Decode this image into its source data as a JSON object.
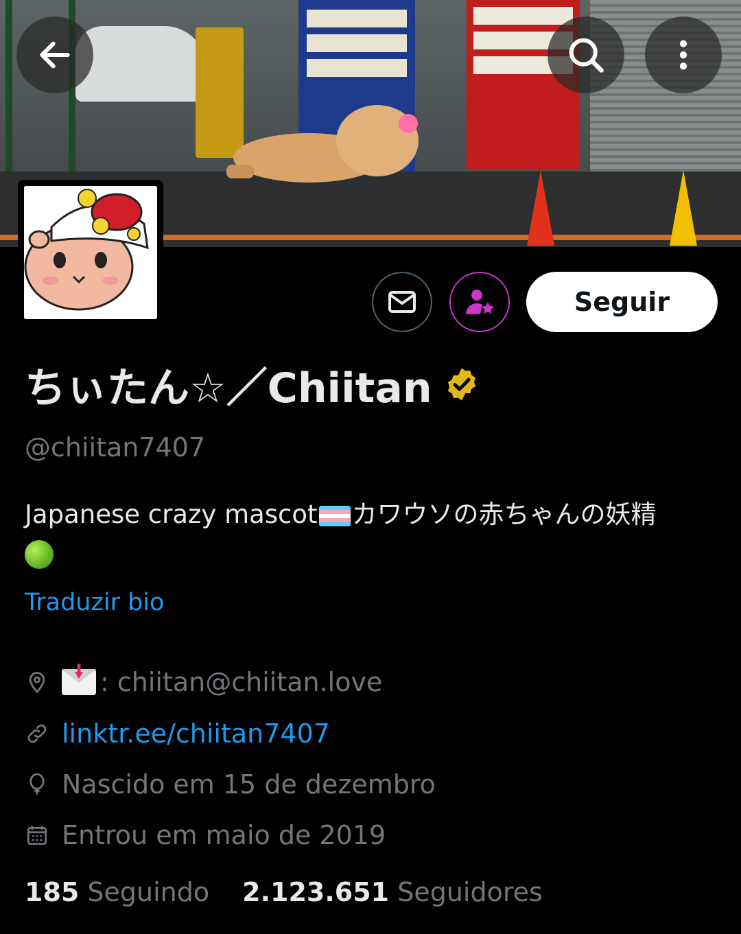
{
  "header": {
    "back_icon": "arrow-left-icon",
    "search_icon": "search-icon",
    "more_icon": "more-vertical-icon"
  },
  "actions": {
    "message_icon": "mail-icon",
    "subscribe_icon": "user-star-icon",
    "follow_label": "Seguir"
  },
  "profile": {
    "name": "ちぃたん☆／Chiitan",
    "verified_icon": "verified-badge-icon",
    "handle": "@chiitan7407",
    "bio_part1": "Japanese crazy mascot",
    "bio_part2": "カワウソの赤ちゃんの妖精",
    "translate_label": "Traduzir bio"
  },
  "meta": {
    "location_icon": "location-pin-icon",
    "location_suffix": ":  chiitan@chiitan.love",
    "link_icon": "link-icon",
    "link_text": "linktr.ee/chiitan7407",
    "birthday_icon": "balloon-icon",
    "birthday_text": "Nascido em 15 de dezembro",
    "joined_icon": "calendar-icon",
    "joined_text": "Entrou em maio de 2019"
  },
  "stats": {
    "following_count": "185",
    "following_label": "Seguindo",
    "followers_count": "2.123.651",
    "followers_label": "Seguidores"
  },
  "colors": {
    "accent_link": "#1d9bf0",
    "muted": "#71767b",
    "subscribe_ring": "#c936c9",
    "verified_gold": "#e2b719"
  }
}
